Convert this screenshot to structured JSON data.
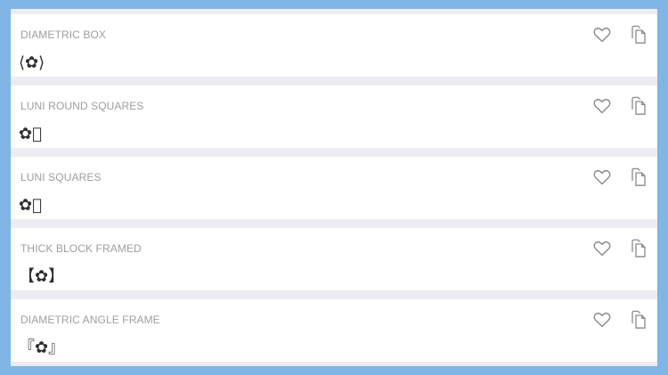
{
  "items": [
    {
      "title": "DIAMETRIC BOX",
      "symbol": "⟨✿⟩",
      "favorite_icon": "heart-outline-icon",
      "copy_icon": "copy-icon"
    },
    {
      "title": "LUNI ROUND SQUARES",
      "symbol": "✿⃞",
      "favorite_icon": "heart-outline-icon",
      "copy_icon": "copy-icon"
    },
    {
      "title": "LUNI SQUARES",
      "symbol": "✿⃞",
      "favorite_icon": "heart-outline-icon",
      "copy_icon": "copy-icon"
    },
    {
      "title": "THICK BLOCK FRAMED",
      "symbol": "【✿】",
      "favorite_icon": "heart-outline-icon",
      "copy_icon": "copy-icon"
    },
    {
      "title": "DIAMETRIC ANGLE FRAME",
      "symbol": "『✿』",
      "favorite_icon": "heart-outline-icon",
      "copy_icon": "copy-icon"
    }
  ],
  "colors": {
    "outer_border": "#7fb6e6",
    "frame_background": "#ededf1",
    "card_background": "#ffffff",
    "title_text": "#9e9e9e",
    "symbol_text": "#2f2f2f",
    "icon_stroke": "#8a8a8a"
  }
}
